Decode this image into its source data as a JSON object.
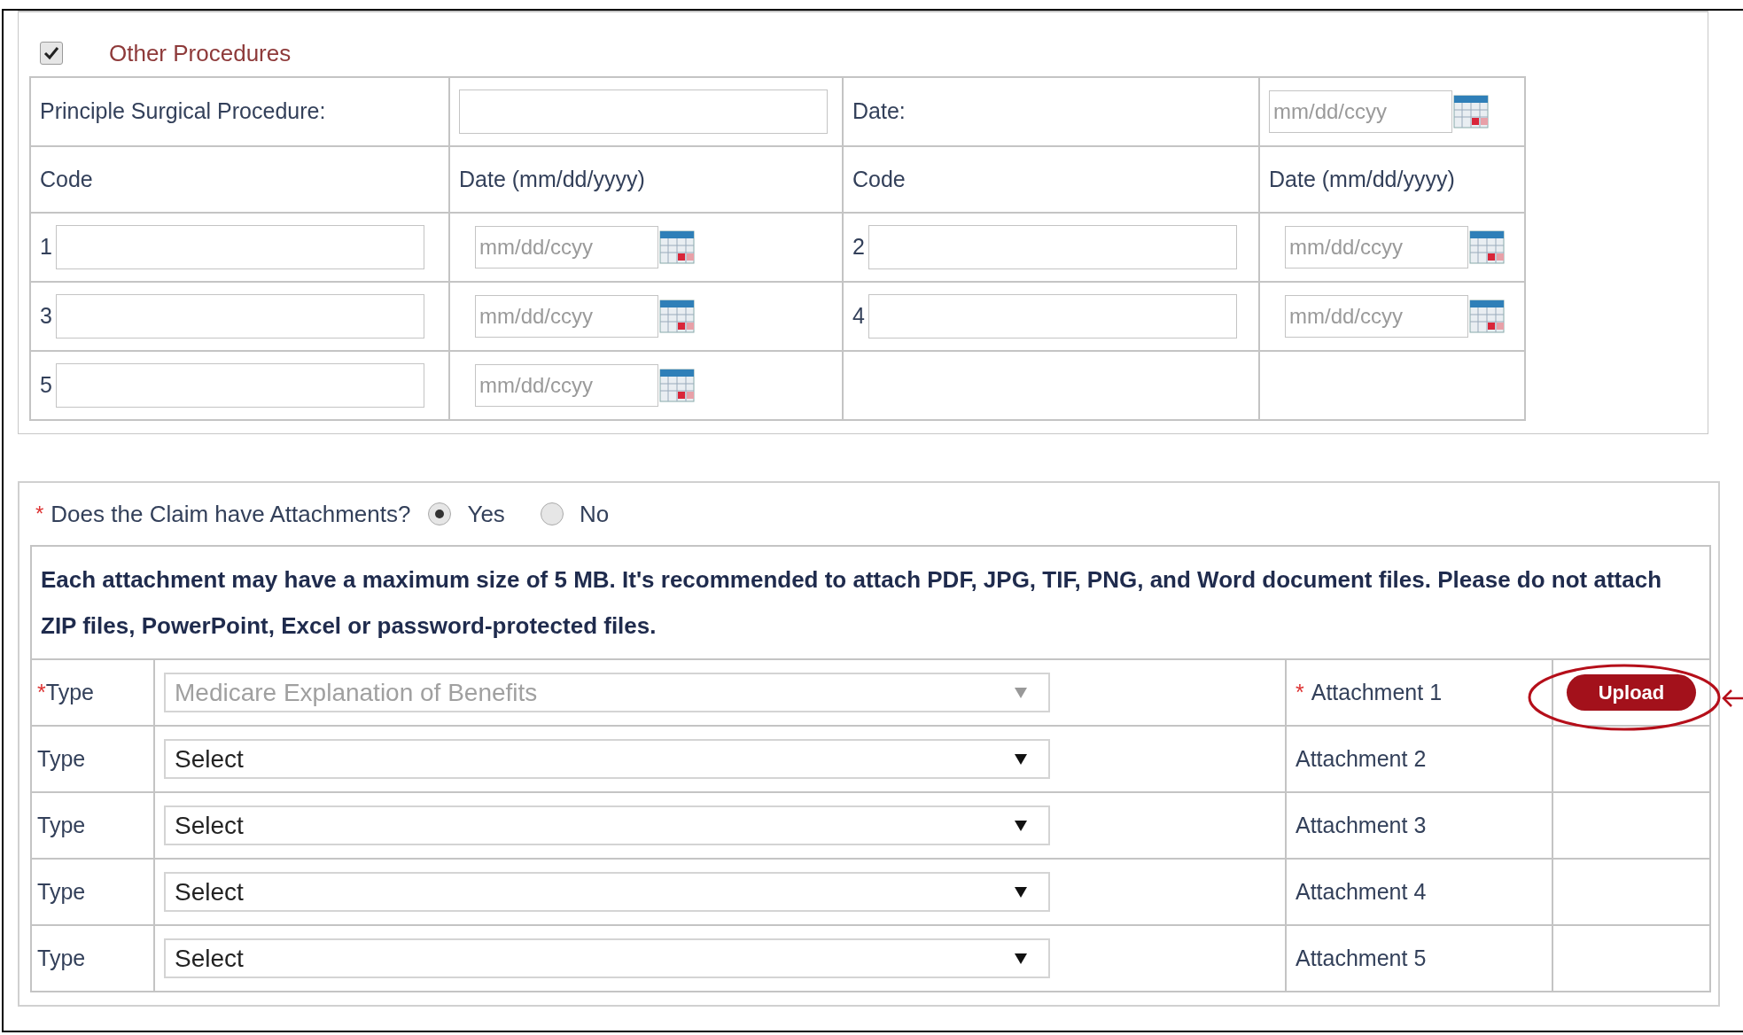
{
  "other_procedures": {
    "checked": true,
    "label": "Other Procedures",
    "principal": {
      "label": "Principle Surgical Procedure:",
      "date_label": "Date:",
      "date_placeholder": "mm/dd/ccyy"
    },
    "column_headers": [
      "Code",
      "Date (mm/dd/yyyy)",
      "Code",
      "Date (mm/dd/yyyy)"
    ],
    "codes": [
      {
        "number": "1",
        "date_placeholder": "mm/dd/ccyy"
      },
      {
        "number": "2",
        "date_placeholder": "mm/dd/ccyy"
      },
      {
        "number": "3",
        "date_placeholder": "mm/dd/ccyy"
      },
      {
        "number": "4",
        "date_placeholder": "mm/dd/ccyy"
      },
      {
        "number": "5",
        "date_placeholder": "mm/dd/ccyy"
      }
    ]
  },
  "attachments": {
    "required_mark": "*",
    "question": "Does the Claim have Attachments?",
    "options": [
      {
        "label": "Yes",
        "selected": true
      },
      {
        "label": "No",
        "selected": false
      }
    ],
    "notice": "Each attachment may have a maximum size of 5 MB. It's recommended to attach PDF, JPG, TIF, PNG, and Word document files. Please do not attach ZIP files, PowerPoint, Excel or password-protected files.",
    "rows": [
      {
        "type_mark": "*",
        "type_label": "Type",
        "value": "Medicare Explanation of Benefits",
        "disabled": true,
        "attachment_mark": "*",
        "attachment": "Attachment 1",
        "upload": "Upload",
        "highlighted": true
      },
      {
        "type_label": "Type",
        "value": "Select",
        "disabled": false,
        "attachment": "Attachment 2"
      },
      {
        "type_label": "Type",
        "value": "Select",
        "disabled": false,
        "attachment": "Attachment 3"
      },
      {
        "type_label": "Type",
        "value": "Select",
        "disabled": false,
        "attachment": "Attachment 4"
      },
      {
        "type_label": "Type",
        "value": "Select",
        "disabled": false,
        "attachment": "Attachment 5"
      }
    ]
  }
}
